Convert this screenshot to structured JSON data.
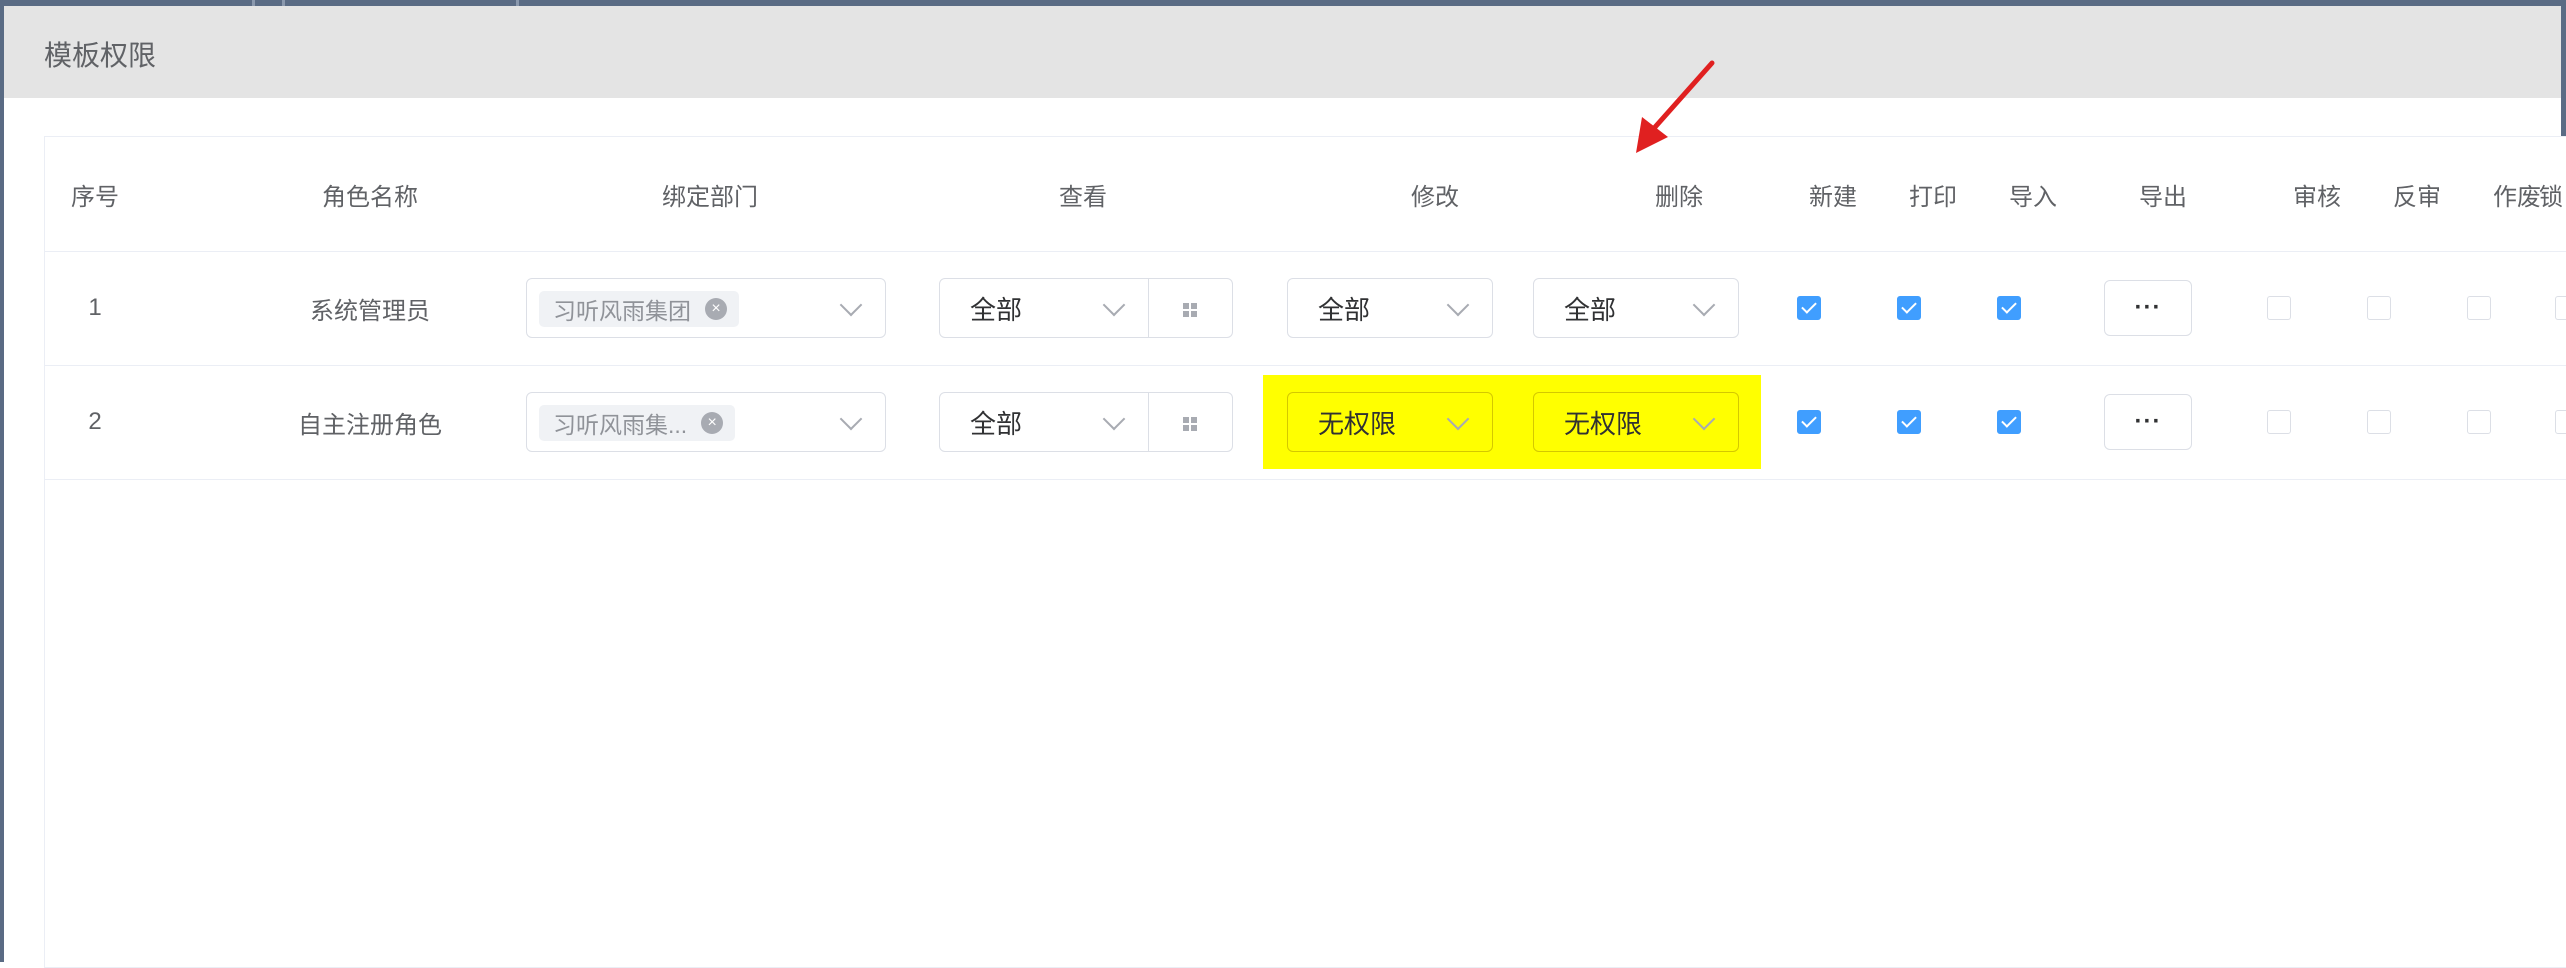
{
  "dialog": {
    "title": "模板权限"
  },
  "columns": {
    "seq": "序号",
    "role": "角色名称",
    "dept": "绑定部门",
    "view": "查看",
    "edit": "修改",
    "delete": "删除",
    "create": "新建",
    "print": "打印",
    "import": "导入",
    "export": "导出",
    "audit": "审核",
    "unaudit": "反审",
    "void": "作废",
    "lock": "锁"
  },
  "rows": [
    {
      "seq": "1",
      "role": "系统管理员",
      "dept_tag": "习听风雨集团",
      "view": "全部",
      "edit": "全部",
      "delete": "全部",
      "create": true,
      "print": true,
      "import": true,
      "export_label": "···",
      "audit": false,
      "unaudit": false,
      "void": false,
      "lock": false
    },
    {
      "seq": "2",
      "role": "自主注册角色",
      "dept_tag": "习听风雨集...",
      "view": "全部",
      "edit": "无权限",
      "delete": "无权限",
      "create": true,
      "print": true,
      "import": true,
      "export_label": "···",
      "audit": false,
      "unaudit": false,
      "void": false,
      "lock": false
    }
  ],
  "colors": {
    "header_bg": "#e4e4e4",
    "highlight": "#ffff00",
    "checkbox_on": "#409eff",
    "annotation_arrow": "#e02020"
  }
}
